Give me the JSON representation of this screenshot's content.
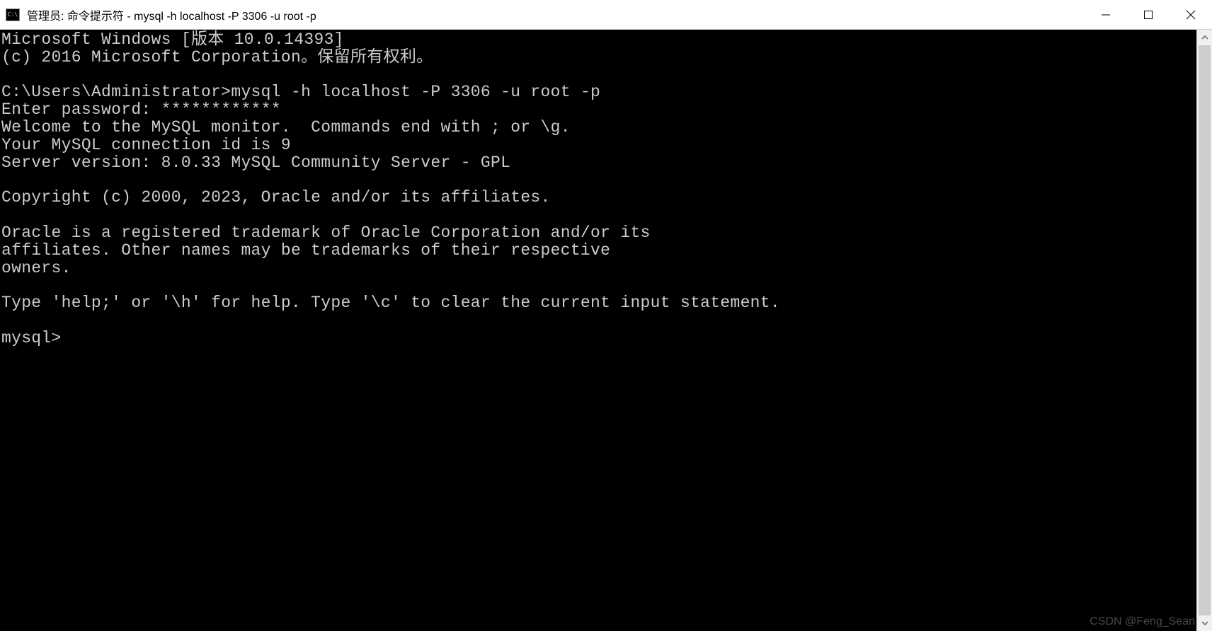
{
  "window": {
    "icon_label": "C:\\",
    "title": "管理员: 命令提示符 - mysql  -h localhost -P 3306 -u root -p"
  },
  "terminal": {
    "lines": [
      "Microsoft Windows [版本 10.0.14393]",
      "(c) 2016 Microsoft Corporation。保留所有权利。",
      "",
      "C:\\Users\\Administrator>mysql -h localhost -P 3306 -u root -p",
      "Enter password: ************",
      "Welcome to the MySQL monitor.  Commands end with ; or \\g.",
      "Your MySQL connection id is 9",
      "Server version: 8.0.33 MySQL Community Server - GPL",
      "",
      "Copyright (c) 2000, 2023, Oracle and/or its affiliates.",
      "",
      "Oracle is a registered trademark of Oracle Corporation and/or its",
      "affiliates. Other names may be trademarks of their respective",
      "owners.",
      "",
      "Type 'help;' or '\\h' for help. Type '\\c' to clear the current input statement.",
      "",
      "mysql>"
    ]
  },
  "watermark": "CSDN @Feng_Sean"
}
